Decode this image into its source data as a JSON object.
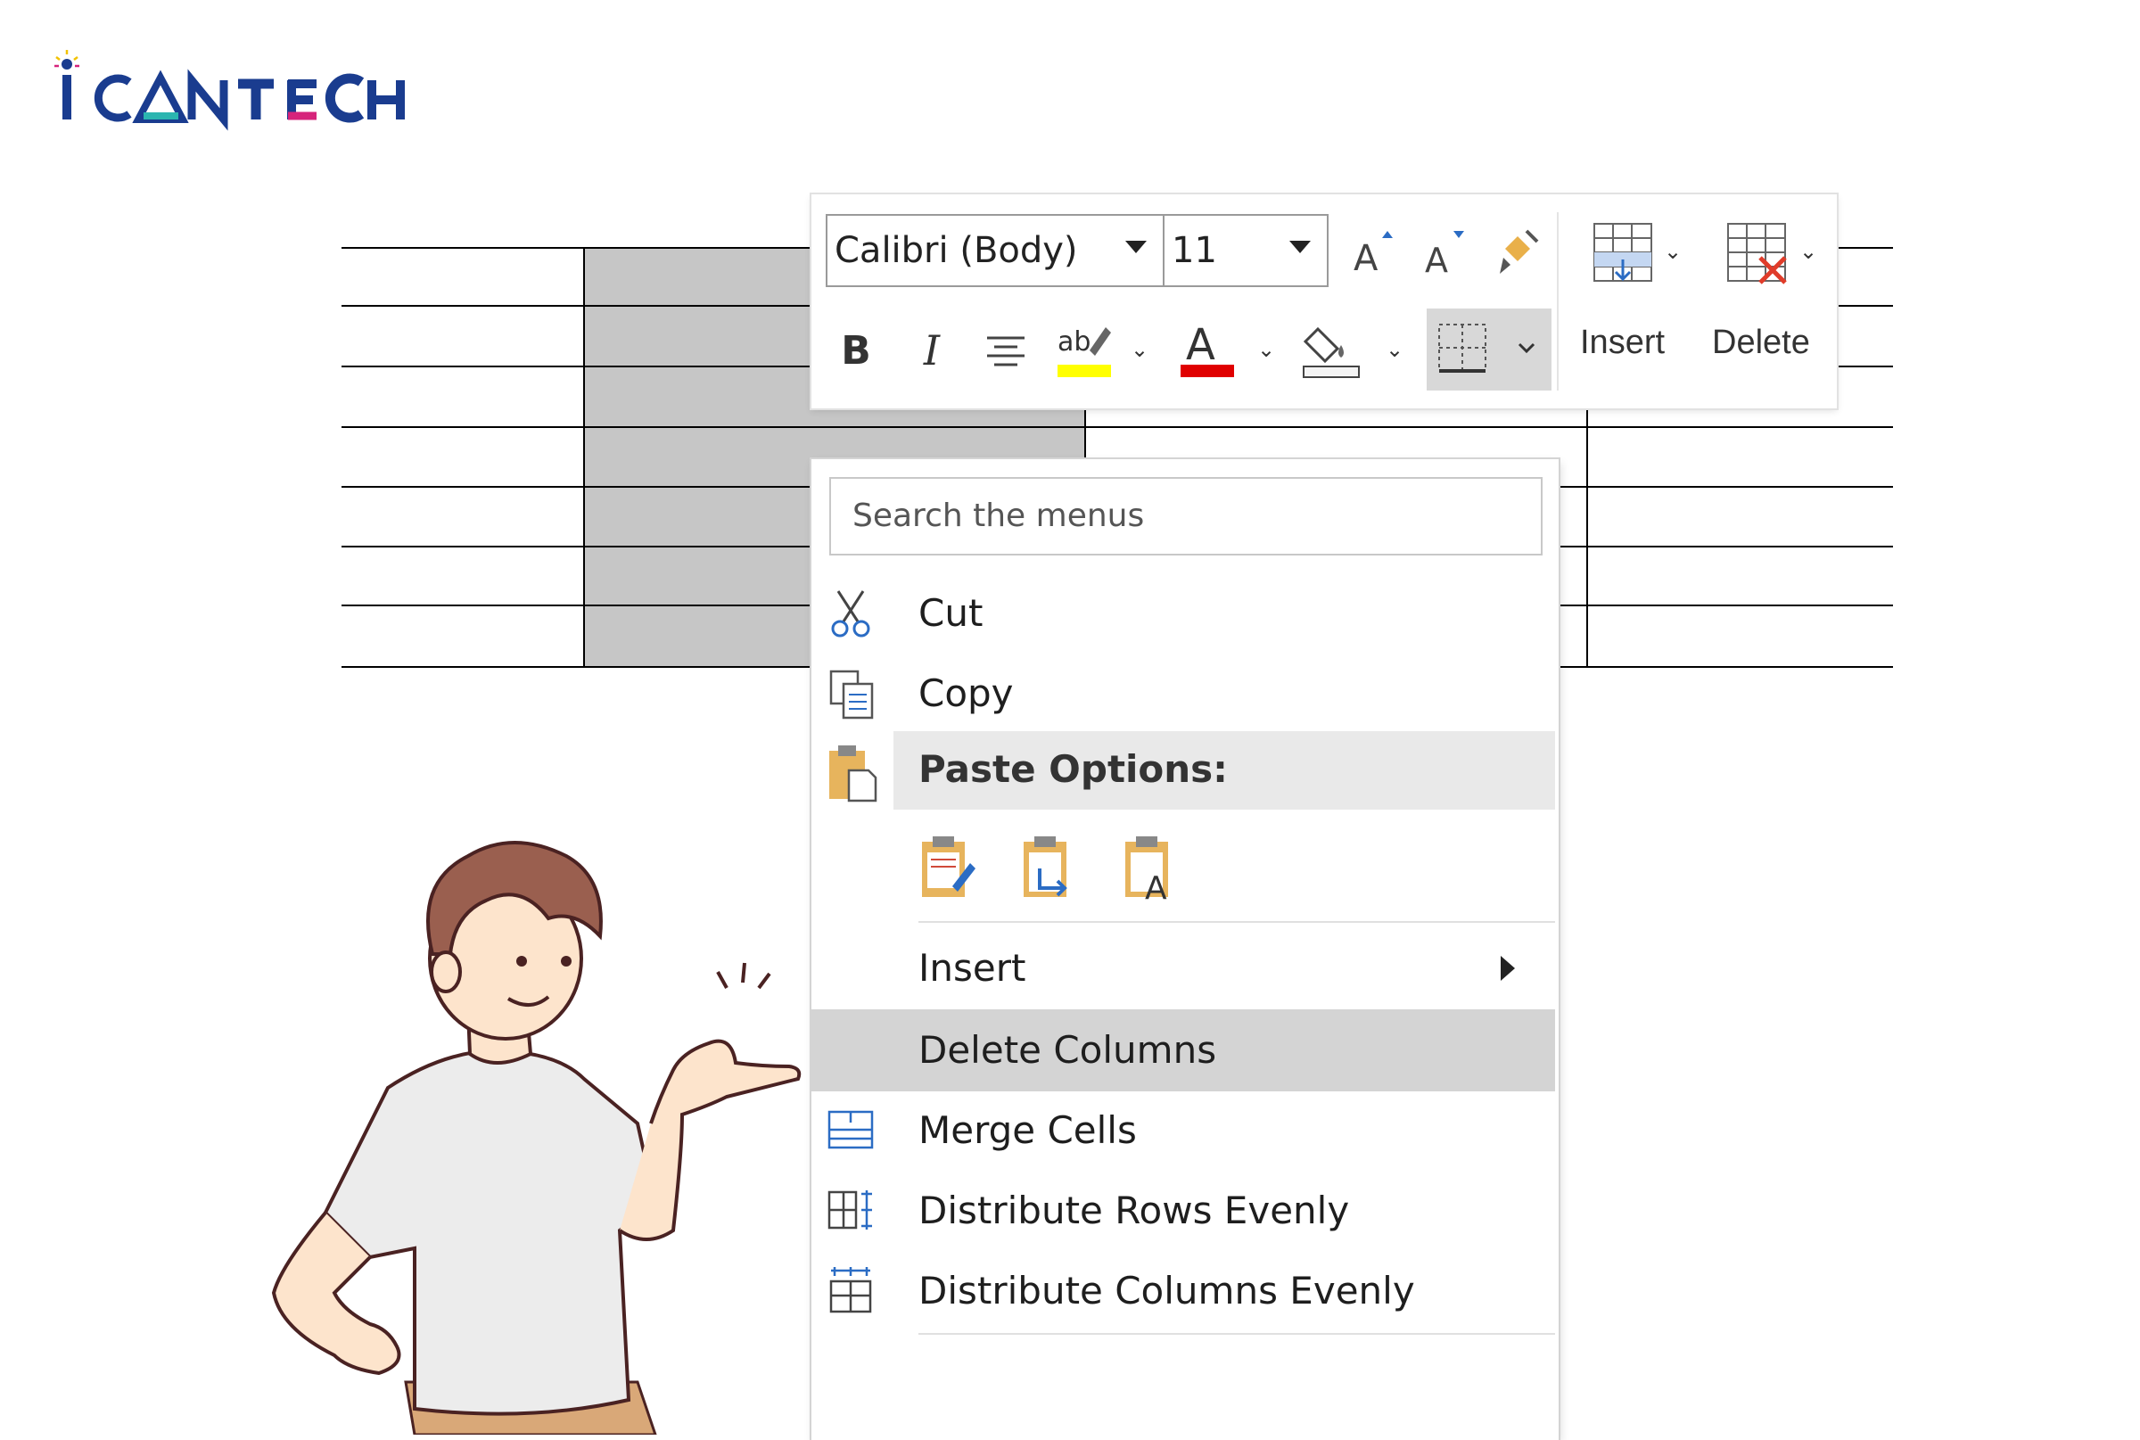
{
  "brand": {
    "logo_text": "iCANTECH",
    "colors": {
      "navy": "#1a3c8f",
      "magenta": "#d6247b",
      "teal": "#2bb5b0",
      "yellow": "#f2c200"
    }
  },
  "toolbar": {
    "font_name": "Calibri (Body)",
    "font_size": "11",
    "grow_font_icon": "grow-font-icon",
    "shrink_font_icon": "shrink-font-icon",
    "format_painter_icon": "format-painter-icon",
    "bold": "B",
    "italic": "I",
    "center_icon": "align-center-icon",
    "highlight_icon": "highlight-icon",
    "font_color_glyph": "A",
    "shading_icon": "shading-icon",
    "borders_icon": "borders-icon",
    "insert_label": "Insert",
    "delete_label": "Delete",
    "highlight_color": "#ffff00",
    "font_color": "#e00000"
  },
  "context_menu": {
    "search_placeholder": "Search the menus",
    "cut": {
      "label": "Cut",
      "icon": "scissors-icon"
    },
    "copy": {
      "label": "Copy",
      "icon": "copy-icon"
    },
    "paste_options": {
      "label": "Paste Options:",
      "icon": "clipboard-icon",
      "options": [
        "keep-source-formatting-icon",
        "merge-formatting-icon",
        "keep-text-only-icon"
      ]
    },
    "insert": {
      "label": "Insert",
      "has_submenu": true
    },
    "delete_columns": {
      "label": "Delete Columns",
      "highlighted": true
    },
    "merge_cells": {
      "label": "Merge Cells",
      "icon": "merge-cells-icon"
    },
    "distribute_rows": {
      "label": "Distribute Rows Evenly",
      "icon": "distribute-rows-icon"
    },
    "distribute_columns": {
      "label": "Distribute Columns Evenly",
      "icon": "distribute-columns-icon"
    }
  },
  "illustration": {
    "subject": "person-pointing-thumb"
  }
}
